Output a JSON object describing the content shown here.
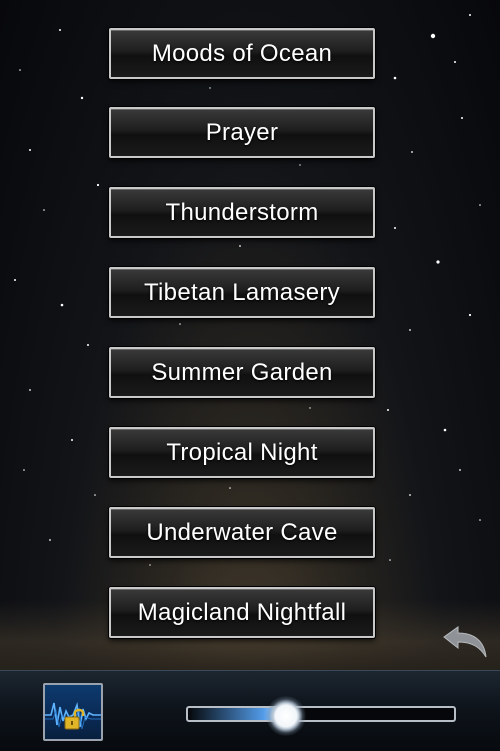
{
  "sound_menu": {
    "items": [
      {
        "label": "Moods of Ocean"
      },
      {
        "label": "Prayer"
      },
      {
        "label": "Thunderstorm"
      },
      {
        "label": "Tibetan Lamasery"
      },
      {
        "label": "Summer Garden"
      },
      {
        "label": "Tropical Night"
      },
      {
        "label": "Underwater Cave"
      },
      {
        "label": "Magicland Nightfall"
      }
    ]
  },
  "controls": {
    "back_icon": "undo-arrow-icon",
    "lock_icon": "unlock-padlock-icon",
    "volume_level": 0.37
  },
  "colors": {
    "button_border": "#c9c9c9",
    "slider_glow": "#5aaaff",
    "lock_gold": "#e0b528"
  }
}
